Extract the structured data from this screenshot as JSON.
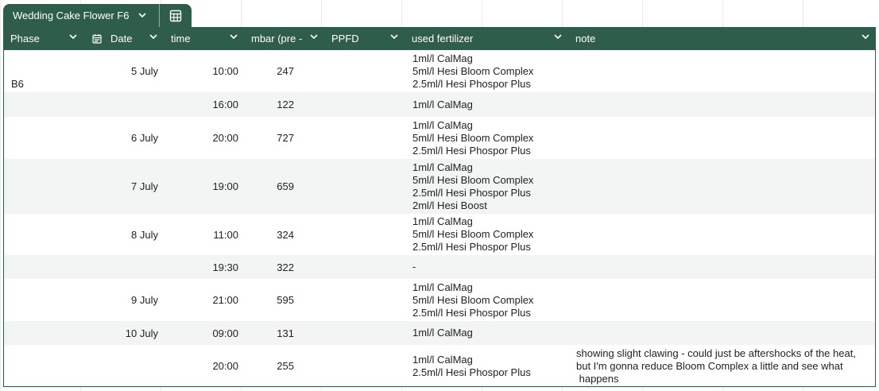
{
  "table": {
    "name": "Wedding Cake Flower F6",
    "view_icon": "calendar-grid-icon"
  },
  "columns": [
    {
      "label": "Phase"
    },
    {
      "label": "Date",
      "icon": "calendar-icon"
    },
    {
      "label": "time"
    },
    {
      "label": "mbar (pre -"
    },
    {
      "label": "PPFD"
    },
    {
      "label": "used fertilizer"
    },
    {
      "label": "note"
    }
  ],
  "rows": [
    {
      "phase": "B6",
      "date": "5 July",
      "time": "10:00",
      "mbar": "247",
      "ppfd": "",
      "fert": [
        "1ml/l CalMag",
        "5ml/l Hesi Bloom Complex",
        "2.5ml/l Hesi Phospor Plus"
      ],
      "note": []
    },
    {
      "phase": "",
      "date": "",
      "time": "16:00",
      "mbar": "122",
      "ppfd": "",
      "fert": [
        "1ml/l CalMag"
      ],
      "note": []
    },
    {
      "phase": "",
      "date": "6 July",
      "time": "20:00",
      "mbar": "727",
      "ppfd": "",
      "fert": [
        "1ml/l CalMag",
        "5ml/l Hesi Bloom Complex",
        "2.5ml/l Hesi Phospor Plus"
      ],
      "note": []
    },
    {
      "phase": "",
      "date": "7 July",
      "time": "19:00",
      "mbar": "659",
      "ppfd": "",
      "fert": [
        "1ml/l CalMag",
        "5ml/l Hesi Bloom Complex",
        "2.5ml/l Hesi Phospor Plus",
        "2ml/l Hesi Boost"
      ],
      "note": []
    },
    {
      "phase": "",
      "date": "8 July",
      "time": "11:00",
      "mbar": "324",
      "ppfd": "",
      "fert": [
        "1ml/l CalMag",
        "5ml/l Hesi Bloom Complex",
        "2.5ml/l Hesi Phospor Plus"
      ],
      "note": []
    },
    {
      "phase": "",
      "date": "",
      "time": "19:30",
      "mbar": "322",
      "ppfd": "",
      "fert": [
        "-"
      ],
      "note": []
    },
    {
      "phase": "",
      "date": "9 July",
      "time": "21:00",
      "mbar": "595",
      "ppfd": "",
      "fert": [
        "1ml/l CalMag",
        "5ml/l Hesi Bloom Complex",
        "2.5ml/l Hesi Phospor Plus"
      ],
      "note": []
    },
    {
      "phase": "",
      "date": "10 July",
      "time": "09:00",
      "mbar": "131",
      "ppfd": "",
      "fert": [
        "1ml/l CalMag"
      ],
      "note": []
    },
    {
      "phase": "",
      "date": "",
      "time": "20:00",
      "mbar": "255",
      "ppfd": "",
      "fert": [
        "1ml/l CalMag",
        "2.5ml/l Hesi Phospor Plus"
      ],
      "note": [
        "showing slight clawing - could just be aftershocks of the heat,",
        "but I'm gonna reduce Bloom Complex a little and see what",
        " happens"
      ]
    }
  ],
  "colors": {
    "header_bg": "#2e5e4a",
    "header_text": "#ffffff",
    "alt_row": "#f3f4f4"
  }
}
